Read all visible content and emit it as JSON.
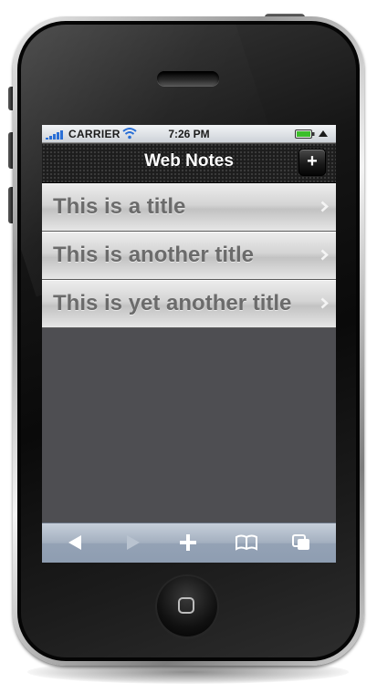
{
  "status_bar": {
    "carrier": "CARRIER",
    "time": "7:26 PM",
    "icons": [
      "signal-bars-icon",
      "wifi-icon",
      "battery-icon",
      "lock-arrow-icon"
    ]
  },
  "nav_bar": {
    "title": "Web Notes",
    "add_label": "+"
  },
  "notes": [
    {
      "title": "This is a title"
    },
    {
      "title": "This is another title"
    },
    {
      "title": "This is yet another title"
    }
  ],
  "toolbar": {
    "icons": [
      "back-icon",
      "forward-icon",
      "plus-icon",
      "bookmarks-icon",
      "pages-icon"
    ],
    "forward_enabled": false
  },
  "colors": {
    "nav_background": "#1d1d1d",
    "row_text": "#6b6b6b",
    "screen_background": "#4e4e52",
    "toolbar_blue": "#a3afbf"
  }
}
